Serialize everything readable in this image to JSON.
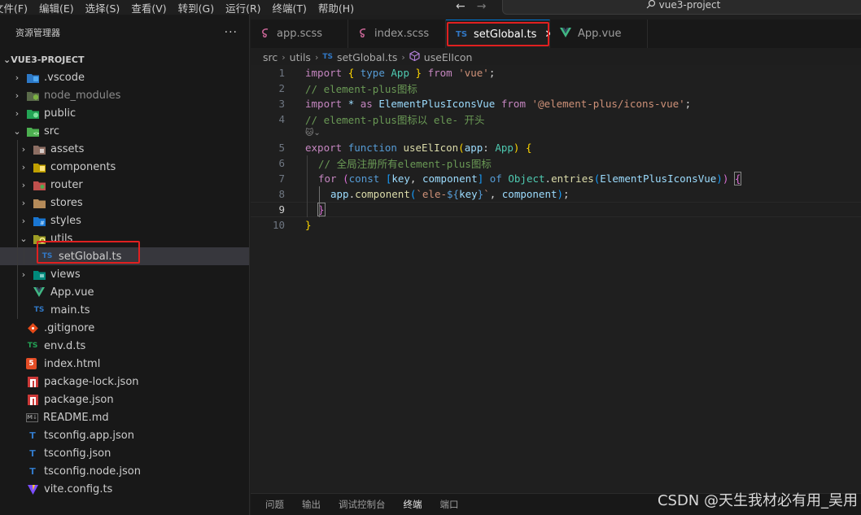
{
  "menu": [
    "文件(F)",
    "编辑(E)",
    "选择(S)",
    "查看(V)",
    "转到(G)",
    "运行(R)",
    "终端(T)",
    "帮助(H)"
  ],
  "nav": {
    "back": "←",
    "forward": "→"
  },
  "search": {
    "icon": "search-icon",
    "text": "vue3-project"
  },
  "sidebar": {
    "title": "资源管理器",
    "more": "···",
    "project": "VUE3-PROJECT",
    "items": [
      {
        "label": ".vscode",
        "icon": "vscode-folder-icon"
      },
      {
        "label": "node_modules",
        "icon": "node-folder-icon"
      },
      {
        "label": "public",
        "icon": "public-folder-icon"
      },
      {
        "label": "src",
        "icon": "src-folder-icon"
      },
      {
        "label": "assets",
        "icon": "assets-folder-icon"
      },
      {
        "label": "components",
        "icon": "components-folder-icon"
      },
      {
        "label": "router",
        "icon": "router-folder-icon"
      },
      {
        "label": "stores",
        "icon": "stores-folder-icon"
      },
      {
        "label": "styles",
        "icon": "styles-folder-icon"
      },
      {
        "label": "utils",
        "icon": "utils-folder-icon"
      },
      {
        "label": "setGlobal.ts",
        "icon": "typescript-icon",
        "badge": "TS"
      },
      {
        "label": "views",
        "icon": "views-folder-icon"
      },
      {
        "label": "App.vue",
        "icon": "vue-icon"
      },
      {
        "label": "main.ts",
        "icon": "typescript-icon",
        "badge": "TS"
      },
      {
        "label": ".gitignore",
        "icon": "git-icon"
      },
      {
        "label": "env.d.ts",
        "icon": "typescript-icon",
        "badge": "TS"
      },
      {
        "label": "index.html",
        "icon": "html-icon",
        "badge": "5"
      },
      {
        "label": "package-lock.json",
        "icon": "npm-icon"
      },
      {
        "label": "package.json",
        "icon": "npm-icon"
      },
      {
        "label": "README.md",
        "icon": "markdown-icon",
        "badge": "M↓"
      },
      {
        "label": "tsconfig.app.json",
        "icon": "tsconfig-icon",
        "badge": "T"
      },
      {
        "label": "tsconfig.json",
        "icon": "tsconfig-icon",
        "badge": "T"
      },
      {
        "label": "tsconfig.node.json",
        "icon": "tsconfig-icon",
        "badge": "T"
      },
      {
        "label": "vite.config.ts",
        "icon": "vite-icon"
      }
    ]
  },
  "tabs": [
    {
      "label": "app.scss",
      "icon": "sass-icon"
    },
    {
      "label": "index.scss",
      "icon": "sass-icon"
    },
    {
      "label": "setGlobal.ts",
      "icon": "typescript-icon",
      "badge": "TS",
      "close": "✕"
    },
    {
      "label": "App.vue",
      "icon": "vue-icon"
    }
  ],
  "breadcrumb": {
    "parts": [
      "src",
      "utils",
      "setGlobal.ts",
      "useElIcon"
    ],
    "sep": "›",
    "ts_badge": "TS"
  },
  "code": {
    "line_numbers": [
      "1",
      "2",
      "3",
      "4",
      "5",
      "6",
      "7",
      "8",
      "9",
      "10"
    ],
    "l1": {
      "import": "import",
      "ob": "{",
      "type": "type",
      "app": "App",
      "cb": "}",
      "from": "from",
      "mod": "'vue'",
      "semi": ";"
    },
    "l2": "// element-plus图标",
    "l3": {
      "import": "import",
      "star": "*",
      "as": "as",
      "name": "ElementPlusIconsVue",
      "from": "from",
      "mod": "'@element-plus/icons-vue'",
      "semi": ";"
    },
    "l4": "// element-plus图标以 ele- 开头",
    "codelens": "🐱⌄",
    "l5": {
      "export": "export",
      "function": "function",
      "name": "useElIcon",
      "op": "(",
      "param": "app",
      "colon": ":",
      "type": "App",
      "cp": ")",
      "ob": "{"
    },
    "l6": "// 全局注册所有element-plus图标",
    "l7": {
      "for": "for",
      "op": "(",
      "const": "const",
      "ob": "[",
      "key": "key",
      "comma": ",",
      "component": "component",
      "cb": "]",
      "of": "of",
      "obj": "Object",
      "dot": ".",
      "entries": "entries",
      "op2": "(",
      "arg": "ElementPlusIconsVue",
      "cp2": ")",
      "cp": ")",
      "brace": "{"
    },
    "l8": {
      "app": "app",
      "dot": ".",
      "component": "component",
      "op": "(",
      "tpl1": "`ele-",
      "d1": "${",
      "key": "key",
      "d2": "}",
      "tpl2": "`",
      "comma": ",",
      "arg": "component",
      "cp": ")",
      "semi": ";"
    },
    "l9": "}",
    "l10": "}"
  },
  "panel": {
    "tabs": [
      "问题",
      "输出",
      "调试控制台",
      "终端",
      "端口"
    ],
    "active": "终端"
  },
  "watermark": "CSDN @天生我材必有用_吴用",
  "colors": {
    "accent_red": "#e02020",
    "ts_blue": "#3178c6",
    "vue_green": "#41b883",
    "sass_pink": "#cd6799"
  }
}
